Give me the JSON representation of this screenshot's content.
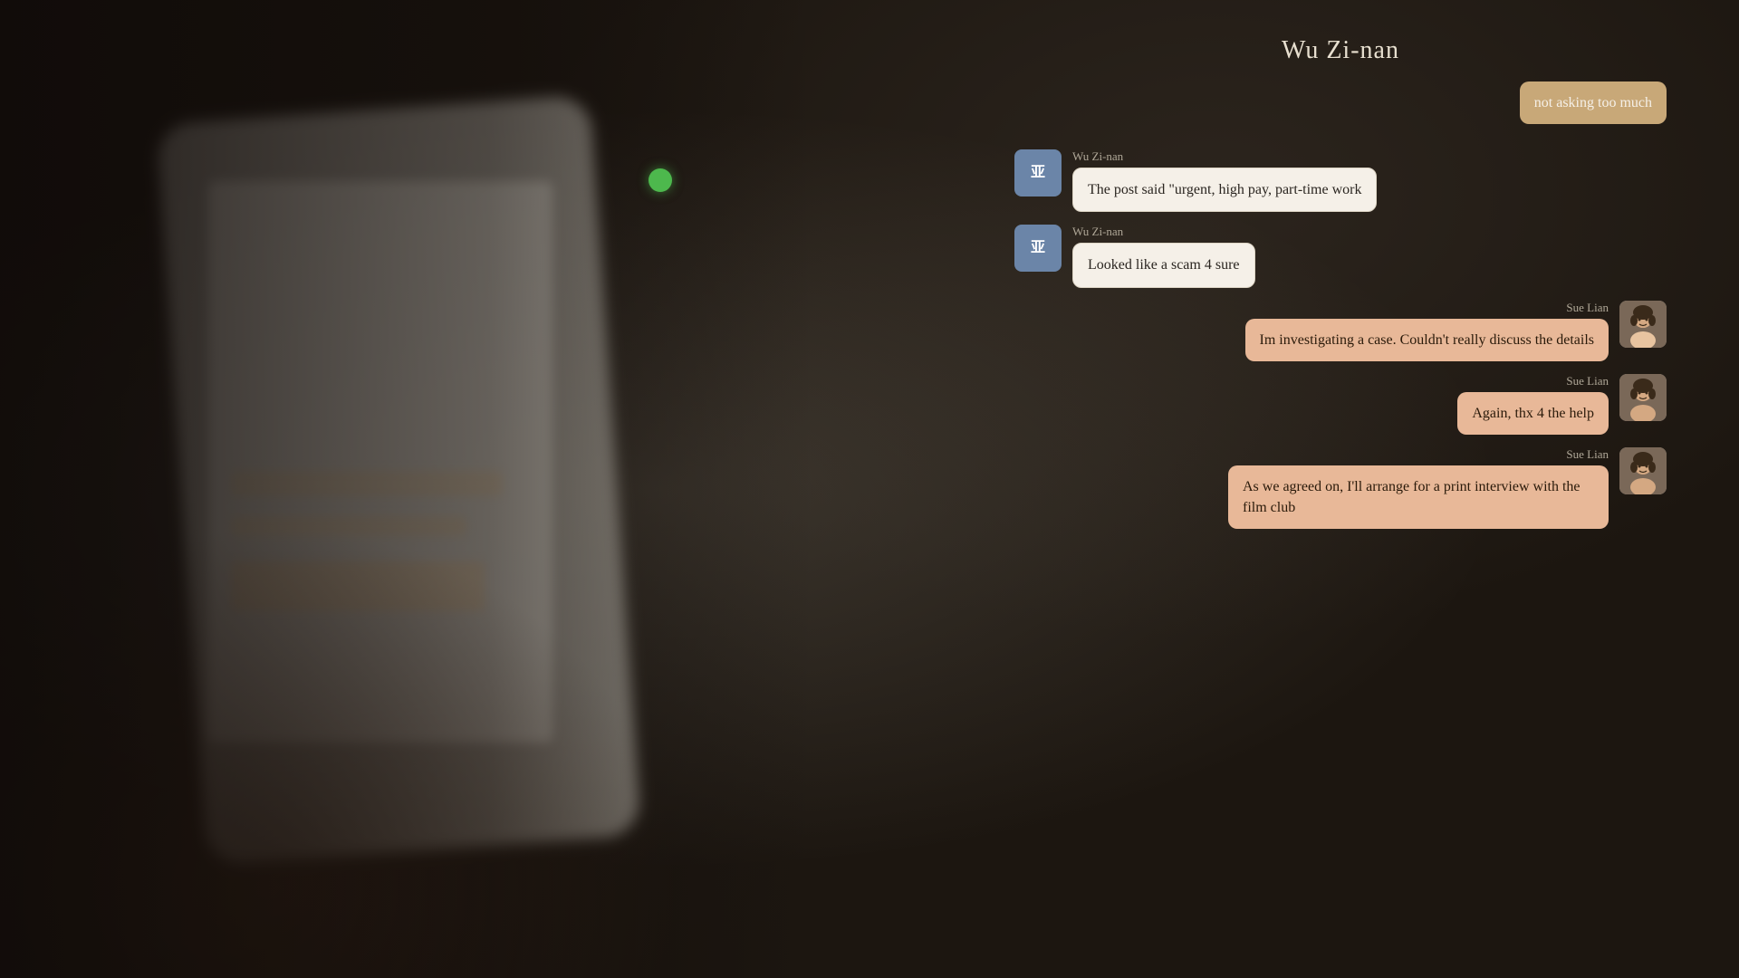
{
  "chat": {
    "title": "Wu Zi-nan",
    "messages": [
      {
        "id": "msg-1",
        "sender": "other",
        "name": "",
        "bubble_style": "tan",
        "text": "not asking too much",
        "avatar": null
      },
      {
        "id": "msg-2",
        "sender": "wu",
        "name": "Wu Zi-nan",
        "bubble_style": "wu",
        "text": "The post said \"urgent, high pay, part-time work",
        "avatar": "wu"
      },
      {
        "id": "msg-3",
        "sender": "wu",
        "name": "Wu Zi-nan",
        "bubble_style": "wu",
        "text": "Looked like a scam 4 sure",
        "avatar": "wu"
      },
      {
        "id": "msg-4",
        "sender": "sue",
        "name": "Sue Lian",
        "bubble_style": "sue",
        "text": "Im investigating a case. Couldn't really discuss the details",
        "avatar": "sue"
      },
      {
        "id": "msg-5",
        "sender": "sue",
        "name": "Sue Lian",
        "bubble_style": "sue",
        "text": "Again, thx 4 the help",
        "avatar": "sue"
      },
      {
        "id": "msg-6",
        "sender": "sue",
        "name": "Sue Lian",
        "bubble_style": "sue",
        "text": "As we agreed on, I'll arrange for a print interview with the film club",
        "avatar": "sue"
      }
    ]
  },
  "phone": {
    "visible": true
  }
}
